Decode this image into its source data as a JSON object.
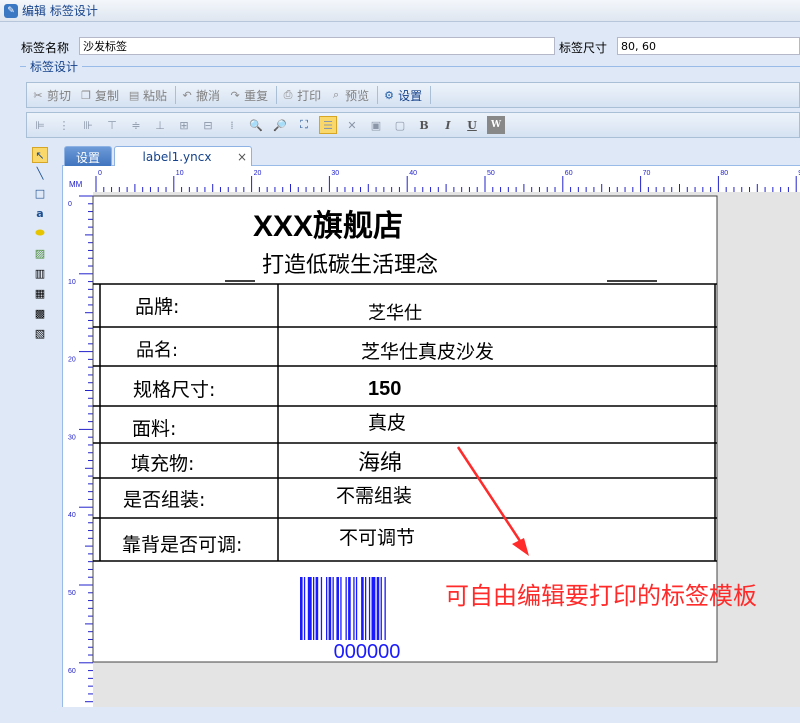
{
  "window": {
    "title": "编辑 标签设计"
  },
  "props": {
    "name_label": "标签名称",
    "name_value": "沙发标签",
    "size_label": "标签尺寸",
    "size_value": "80, 60"
  },
  "section": {
    "legend": "标签设计"
  },
  "toolbar": {
    "cut": "剪切",
    "copy": "复制",
    "paste": "粘贴",
    "undo": "撤消",
    "redo": "重复",
    "print": "打印",
    "preview": "预览",
    "settings": "设置"
  },
  "tabs": {
    "settings": "设置",
    "file": "label1.yncx",
    "close": "×"
  },
  "ruler": {
    "unit": "MM",
    "h_labels": [
      "0",
      "10",
      "20",
      "30",
      "40",
      "50",
      "60",
      "70",
      "80",
      "9"
    ],
    "v_labels": [
      "0",
      "10",
      "20",
      "30",
      "40",
      "50",
      "60"
    ]
  },
  "label": {
    "store": "XXX旗舰店",
    "slogan": "打造低碳生活理念",
    "rows": [
      {
        "key": "品牌:",
        "value": "芝华仕"
      },
      {
        "key": "品名:",
        "value": "芝华仕真皮沙发"
      },
      {
        "key": "规格尺寸:",
        "value": "150"
      },
      {
        "key": "面料:",
        "value": "真皮"
      },
      {
        "key": "填充物:",
        "value": "海绵"
      },
      {
        "key": "是否组装:",
        "value": "不需组装"
      },
      {
        "key": "靠背是否可调:",
        "value": "不可调节"
      }
    ],
    "barcode": "000000"
  },
  "annotation": "可自由编辑要打印的标签模板",
  "colors": {
    "accent": "#15428b",
    "ruler": "#2222cc",
    "annotation": "#ff2a2a",
    "barcode": "#1a1aff"
  }
}
